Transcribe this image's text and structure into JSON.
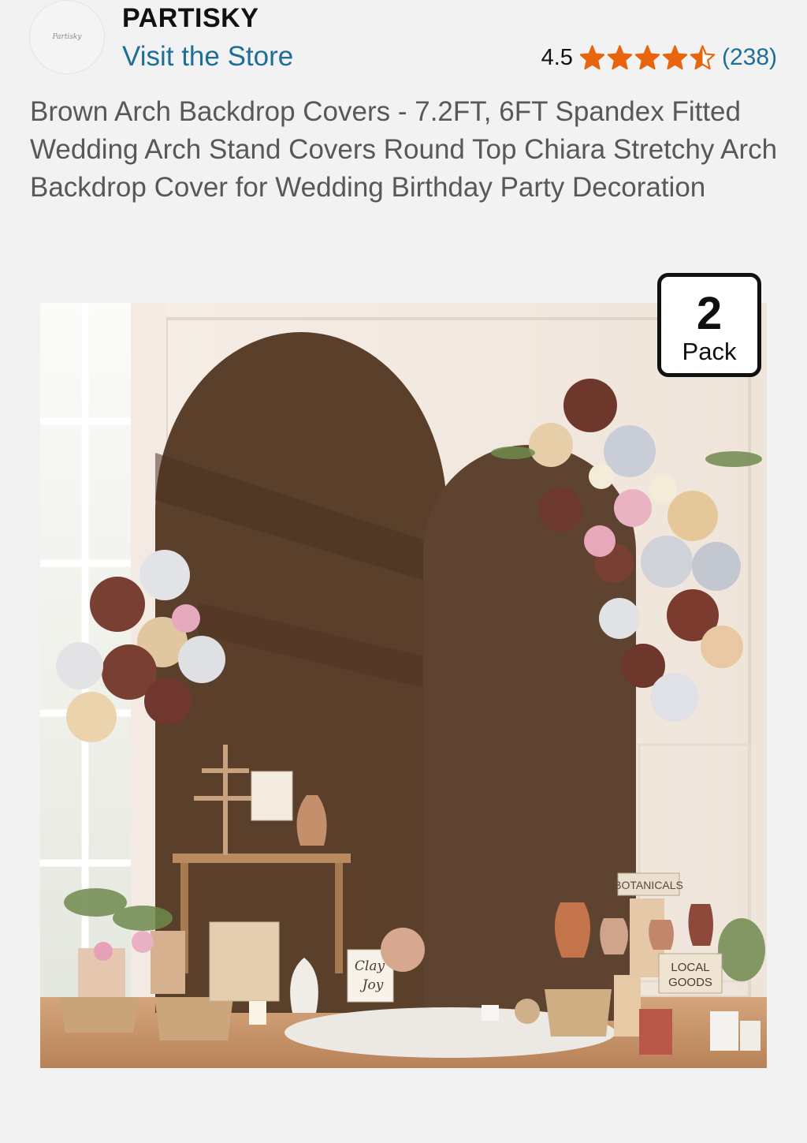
{
  "store": {
    "logo_text": "Partisky",
    "brand": "PARTISKY",
    "visit_label": "Visit the Store"
  },
  "rating": {
    "value": "4.5",
    "stars": 4.5,
    "review_count": "(238)",
    "star_color": "#e8650f"
  },
  "product": {
    "title": "Brown Arch Backdrop Covers - 7.2FT, 6FT Spandex Fitted Wedding Arch Stand Covers Round Top Chiara Stretchy Arch Backdrop Cover for Wedding Birthday Party Decoration",
    "badge_number": "2",
    "badge_label": "Pack",
    "image_signs": {
      "sign1": "BOTANICALS",
      "sign2_line1": "LOCAL",
      "sign2_line2": "GOODS",
      "card1_line1": "Clay",
      "card1_line2": "Joy"
    }
  },
  "colors": {
    "arch_brown": "#5a3f2b",
    "link_blue": "#1f6e98"
  }
}
